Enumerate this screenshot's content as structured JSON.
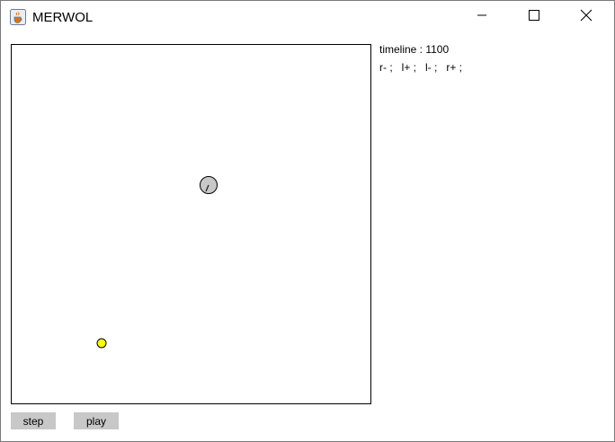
{
  "window": {
    "title": "MERWOL",
    "icon": "java-cup-icon",
    "controls": [
      "minimize-icon",
      "maximize-icon",
      "close-icon"
    ]
  },
  "info": {
    "timeline": "timeline : 1100",
    "key_states": "r- ;   l+ ;   l- ;   r+ ;"
  },
  "simulation": {
    "agent": {
      "fill": "#c8c8c8",
      "stroke": "#000000"
    },
    "food": {
      "fill": "#ffff00",
      "stroke": "#000000"
    }
  },
  "buttons": {
    "step": "step",
    "play": "play"
  },
  "colors": {
    "button_bg": "#c8c8c8",
    "food": "#ffff00",
    "agent": "#c8c8c8"
  }
}
